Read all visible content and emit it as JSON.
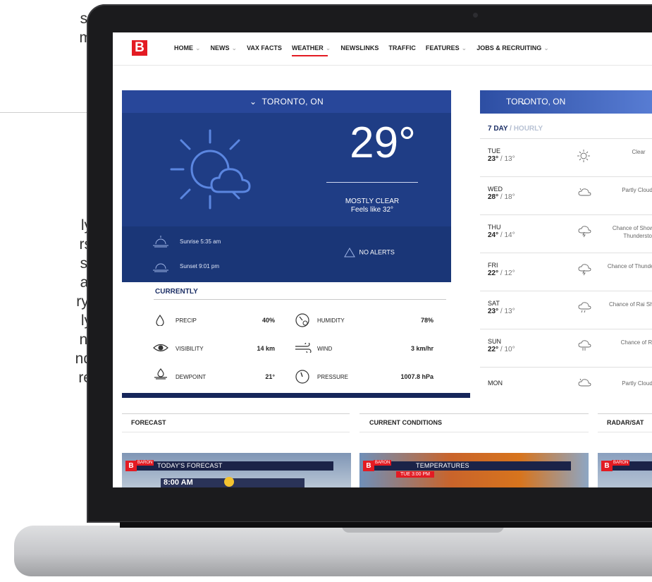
{
  "side_text": {
    "top_lines": [
      "s.",
      "m"
    ],
    "mid_lines": [
      "ly",
      "rs",
      "s,",
      "al",
      "ry,",
      "ly",
      "nt",
      "nd",
      "re"
    ]
  },
  "nav": {
    "logo_letter": "B",
    "items": [
      {
        "label": "HOME",
        "chevron": "⌄"
      },
      {
        "label": "NEWS",
        "chevron": "⌄"
      },
      {
        "label": "VAX FACTS",
        "chevron": ""
      },
      {
        "label": "WEATHER",
        "chevron": "⌄"
      },
      {
        "label": "NEWSLINKS",
        "chevron": ""
      },
      {
        "label": "TRAFFIC",
        "chevron": ""
      },
      {
        "label": "FEATURES",
        "chevron": "⌄"
      },
      {
        "label": "JOBS & RECRUITING",
        "chevron": "⌄"
      }
    ],
    "active": "WEATHER"
  },
  "current": {
    "location": "TORONTO, ON",
    "chevron": "⌄",
    "temperature": "29°",
    "condition": "MOSTLY CLEAR",
    "feels_like": "Feels like 32°",
    "sunrise": "Sunrise 5:35 am",
    "sunset": "Sunset 9:01 pm",
    "alerts": "NO ALERTS"
  },
  "currently": {
    "title": "CURRENTLY",
    "stats": [
      {
        "label": "PRECIP",
        "value": "40%",
        "icon": "drop-icon"
      },
      {
        "label": "HUMIDITY",
        "value": "78%",
        "icon": "humidity-gauge-icon"
      },
      {
        "label": "VISIBILITY",
        "value": "14 km",
        "icon": "eye-icon"
      },
      {
        "label": "WIND",
        "value": "3 km/hr",
        "icon": "wind-icon"
      },
      {
        "label": "DEWPOINT",
        "value": "21°",
        "icon": "dewpoint-icon"
      },
      {
        "label": "PRESSURE",
        "value": "1007.8 hPa",
        "icon": "pressure-gauge-icon"
      }
    ]
  },
  "forecast_panel": {
    "location": "TORONTO, ON",
    "tab_active": "7 DAY",
    "tab_sep": "/",
    "tab_inactive": "HOURLY",
    "days": [
      {
        "day": "TUE",
        "high": "23°",
        "low": "13°",
        "condition": "Clear",
        "icon": "sun-icon"
      },
      {
        "day": "WED",
        "high": "28°",
        "low": "18°",
        "condition": "Partly Cloudy",
        "icon": "partly-cloudy-icon"
      },
      {
        "day": "THU",
        "high": "24°",
        "low": "14°",
        "condition": "Chance of Show and Thunderstor",
        "icon": "thunderstorm-icon"
      },
      {
        "day": "FRI",
        "high": "22°",
        "low": "12°",
        "condition": "Chance of Thunderstorm",
        "icon": "thunderstorm-icon"
      },
      {
        "day": "SAT",
        "high": "23°",
        "low": "13°",
        "condition": "Chance of Rai Showers",
        "icon": "rain-showers-icon"
      },
      {
        "day": "SUN",
        "high": "22°",
        "low": "10°",
        "condition": "Chance of Rai",
        "icon": "rain-icon"
      },
      {
        "day": "MON",
        "high": "",
        "low": "",
        "condition": "Partly Cloudy",
        "icon": "partly-cloudy-icon"
      }
    ]
  },
  "sections": {
    "forecast": "FORECAST",
    "current_conditions": "CURRENT CONDITIONS",
    "radar": "RADAR/SAT"
  },
  "thumbnails": [
    {
      "brand": "BARON",
      "label": "TODAY'S FORECAST",
      "sub": "8:00 AM"
    },
    {
      "brand": "BARON",
      "label": "TEMPERATURES",
      "sub": "TUE 3:00 PM"
    },
    {
      "brand": "BARON",
      "label": "",
      "sub": ""
    }
  ],
  "colors": {
    "panel_blue": "#1f3d85",
    "accent_red": "#e31b23",
    "navy": "#16265a"
  }
}
